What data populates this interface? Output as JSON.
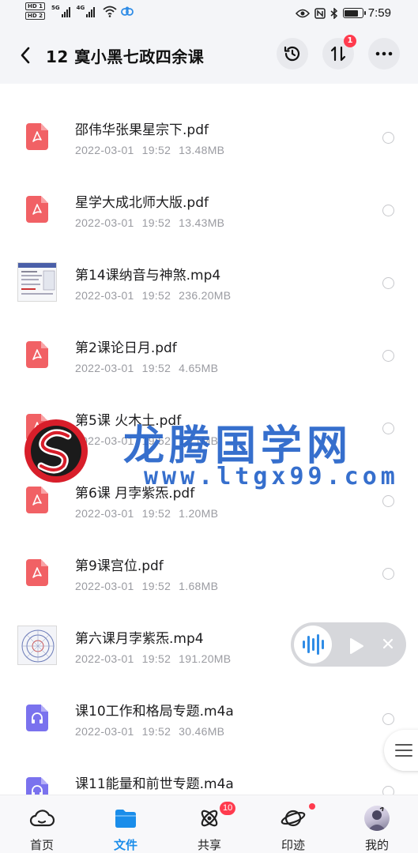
{
  "status_bar": {
    "hd1": "HD 1",
    "hd2": "HD 2",
    "sim1_label": "5G",
    "sim2_label": "4G",
    "battery_level": 0.8,
    "time": "7:59"
  },
  "header": {
    "title": "12 寞小黑七政四余课",
    "transfer_badge": "1"
  },
  "files": [
    {
      "type": "pdf",
      "name": "邵伟华张果星宗下.pdf",
      "date": "2022-03-01",
      "time": "19:52",
      "size": "13.48MB"
    },
    {
      "type": "pdf",
      "name": "星学大成北师大版.pdf",
      "date": "2022-03-01",
      "time": "19:52",
      "size": "13.43MB"
    },
    {
      "type": "video",
      "name": "第14课纳音与神煞.mp4",
      "date": "2022-03-01",
      "time": "19:52",
      "size": "236.20MB"
    },
    {
      "type": "pdf",
      "name": "第2课论日月.pdf",
      "date": "2022-03-01",
      "time": "19:52",
      "size": "4.65MB"
    },
    {
      "type": "pdf",
      "name": "第5课 火木土.pdf",
      "date": "2022-03-01",
      "time": "19:52",
      "size": "1.71MB"
    },
    {
      "type": "pdf",
      "name": "第6课 月孛紫炁.pdf",
      "date": "2022-03-01",
      "time": "19:52",
      "size": "1.20MB"
    },
    {
      "type": "pdf",
      "name": "第9课宫位.pdf",
      "date": "2022-03-01",
      "time": "19:52",
      "size": "1.68MB"
    },
    {
      "type": "video",
      "name": "第六课月孛紫炁.mp4",
      "date": "2022-03-01",
      "time": "19:52",
      "size": "191.20MB"
    },
    {
      "type": "audio",
      "name": "课10工作和格局专题.m4a",
      "date": "2022-03-01",
      "time": "19:52",
      "size": "30.46MB"
    },
    {
      "type": "audio",
      "name": "课11能量和前世专题.m4a",
      "date": "",
      "time": "",
      "size": ""
    }
  ],
  "watermark": {
    "title": "龙腾国学网",
    "url": "www.ltgx99.com"
  },
  "bottom_nav": [
    {
      "label": "首页",
      "icon": "cloud-home-icon",
      "active": false
    },
    {
      "label": "文件",
      "icon": "folder-icon",
      "active": true
    },
    {
      "label": "共享",
      "icon": "share-atom-icon",
      "active": false,
      "badge": "10"
    },
    {
      "label": "印迹",
      "icon": "planet-icon",
      "active": false,
      "dot": true
    },
    {
      "label": "我的",
      "icon": "avatar",
      "active": false
    }
  ],
  "colors": {
    "accent": "#1a8dea",
    "pdf": "#f16165",
    "audio": "#7a72ee",
    "badge": "#ff3b4e",
    "watermark": "#2563c9"
  }
}
